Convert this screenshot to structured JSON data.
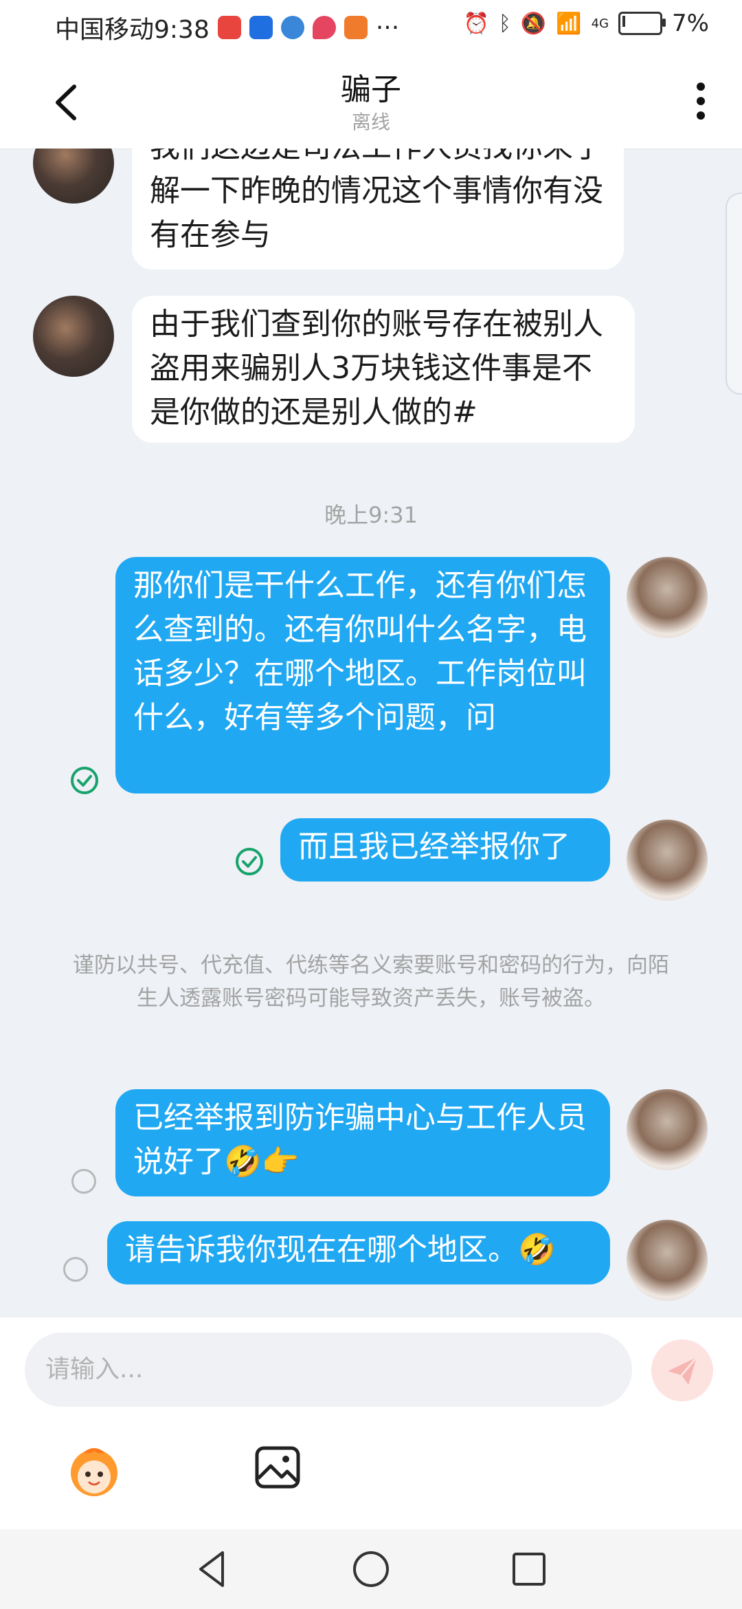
{
  "status_bar": {
    "carrier_time": "中国移动9:38",
    "more": "···",
    "signal": "4G",
    "battery": "7%",
    "battery_level": 0.07
  },
  "header": {
    "back_icon": "chevron-left-icon",
    "title": "骗子",
    "status": "离线",
    "menu_icon": "more-vertical-icon"
  },
  "messages": [
    {
      "side": "in",
      "text": "我们这边是司法工作人员找你来了解一下昨晚的情况这个事情你有没有在参与"
    },
    {
      "side": "in",
      "text": "由于我们查到你的账号存在被别人盗用来骗别人3万块钱这件事是不是你做的还是别人做的#"
    },
    {
      "side": "time",
      "text": "晚上9:31"
    },
    {
      "side": "out",
      "text": "那你们是干什么工作，还有你们怎么查到的。还有你叫什么名字，电话多少？在哪个地区。工作岗位叫什么，好有等多个问题，问",
      "status": "read"
    },
    {
      "side": "out",
      "text": "而且我已经举报你了",
      "status": "read"
    },
    {
      "side": "notice",
      "text": "谨防以共号、代充值、代练等名义索要账号和密码的行为，向陌生人透露账号密码可能导致资产丢失，账号被盗。"
    },
    {
      "side": "out",
      "text": "已经举报到防诈骗中心与工作人员说好了🤣👉",
      "status": "unread"
    },
    {
      "side": "out",
      "text": "请告诉我你现在在哪个地区。🤣",
      "status": "unread"
    }
  ],
  "composer": {
    "placeholder": "请输入...",
    "send_icon": "send-icon",
    "emoji_icon": "mascot-emoji-icon",
    "image_icon": "image-icon"
  },
  "colors": {
    "outgoing_bubble": "#20a8f2",
    "incoming_bubble": "#ffffff",
    "background": "#eef1f6",
    "read_check": "#17a36b"
  }
}
